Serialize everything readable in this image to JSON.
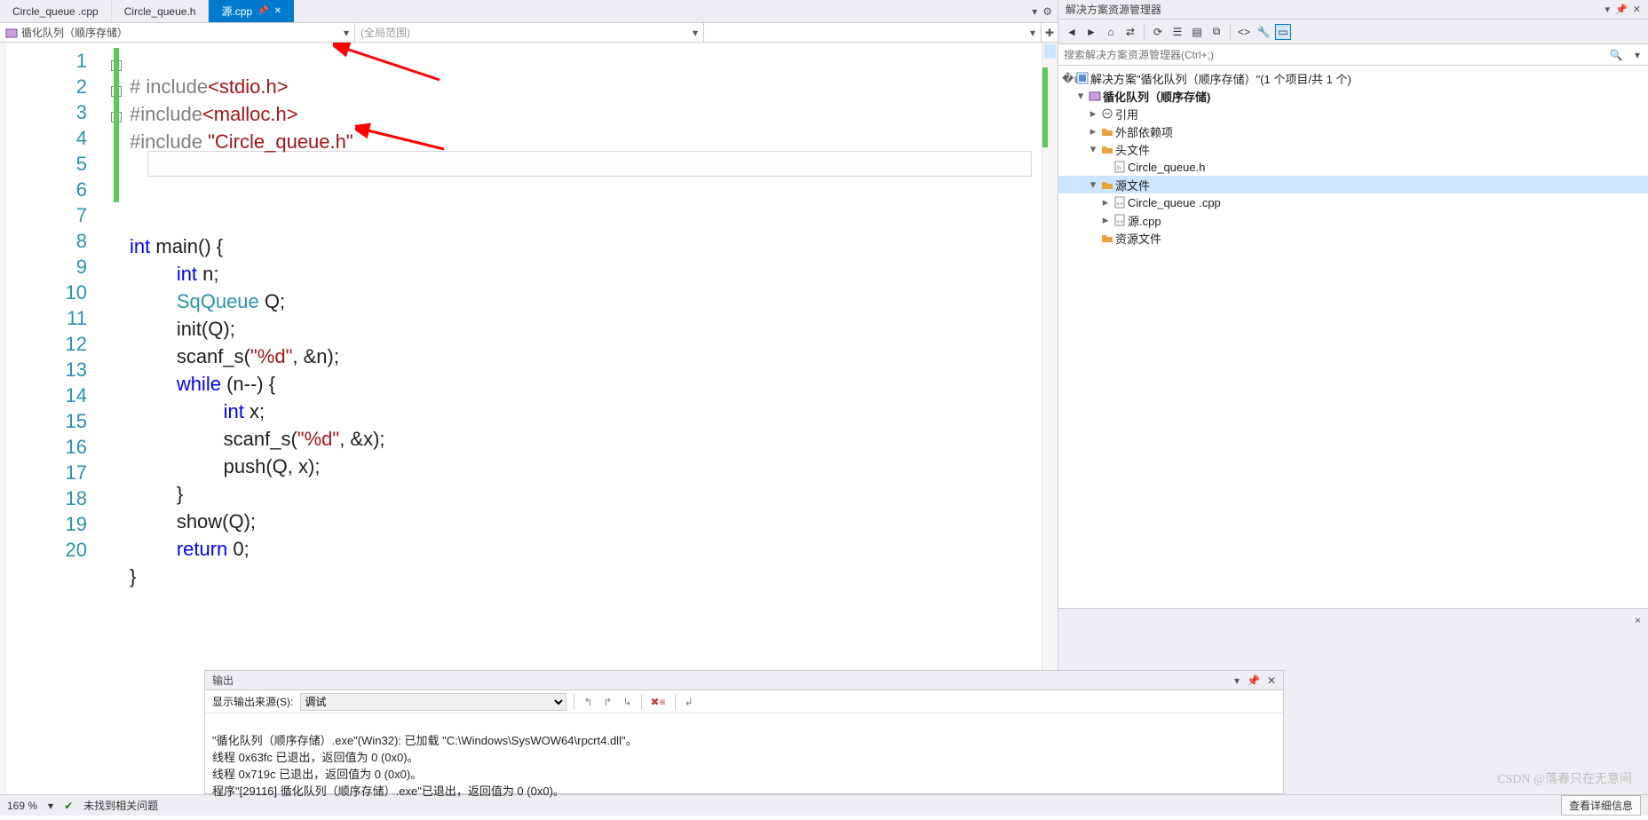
{
  "tabs": [
    {
      "label": "Circle_queue .cpp",
      "active": false
    },
    {
      "label": "Circle_queue.h",
      "active": false
    },
    {
      "label": "源.cpp",
      "active": true
    }
  ],
  "nav": {
    "scope1_icon": "project-icon",
    "scope1": "循化队列（顺序存储）",
    "scope2": "(全局范围)",
    "scope3": ""
  },
  "line_numbers": [
    "1",
    "2",
    "3",
    "4",
    "5",
    "6",
    "7",
    "8",
    "9",
    "10",
    "11",
    "12",
    "13",
    "14",
    "15",
    "16",
    "17",
    "18",
    "19",
    "20"
  ],
  "code": {
    "l1_pp": "# include",
    "l1_ang": "<stdio.h>",
    "l2_pp": "#include",
    "l2_ang": "<malloc.h>",
    "l3_pp": "#include ",
    "l3_str": "\"Circle_queue.h\"",
    "l7_a": "int",
    "l7_b": " main() {",
    "l8_a": "int",
    "l8_b": " n;",
    "l9_a": "SqQueue",
    "l9_b": " Q;",
    "l10": "init(Q);",
    "l11_a": "scanf_s(",
    "l11_b": "\"%d\"",
    "l11_c": ", &n);",
    "l12_a": "while",
    "l12_b": " (n--) {",
    "l13_a": "int",
    "l13_b": " x;",
    "l14_a": "scanf_s(",
    "l14_b": "\"%d\"",
    "l14_c": ", &x);",
    "l15": "push(Q, x);",
    "l16": "}",
    "l17": "show(Q);",
    "l18_a": "return",
    "l18_b": " 0;",
    "l19": "}"
  },
  "output": {
    "title": "输出",
    "source_label": "显示输出来源(S):",
    "source_value": "调试",
    "lines": [
      "\"循化队列（顺序存储）.exe\"(Win32): 已加载 \"C:\\Windows\\SysWOW64\\rpcrt4.dll\"。",
      "线程 0x63fc 已退出，返回值为 0 (0x0)。",
      "线程 0x719c 已退出，返回值为 0 (0x0)。",
      "程序\"[29116] 循化队列（顺序存储）.exe\"已退出，返回值为 0 (0x0)。"
    ]
  },
  "explorer": {
    "title": "解决方案资源管理器",
    "search_placeholder": "搜索解决方案资源管理器(Ctrl+;)",
    "solution": "解决方案\"循化队列（顺序存储）\"(1 个项目/共 1 个)",
    "project": "循化队列（顺序存储)",
    "refs": "引用",
    "external": "外部依赖项",
    "headers": "头文件",
    "header1": "Circle_queue.h",
    "sources": "源文件",
    "src1": "Circle_queue .cpp",
    "src2": "源.cpp",
    "resources": "资源文件"
  },
  "status": {
    "zoom": "169 %",
    "issues": "未找到相关问题",
    "detail_btn": "查看详细信息"
  },
  "watermark": "CSDN @落春只在无意间",
  "side_close": "×"
}
